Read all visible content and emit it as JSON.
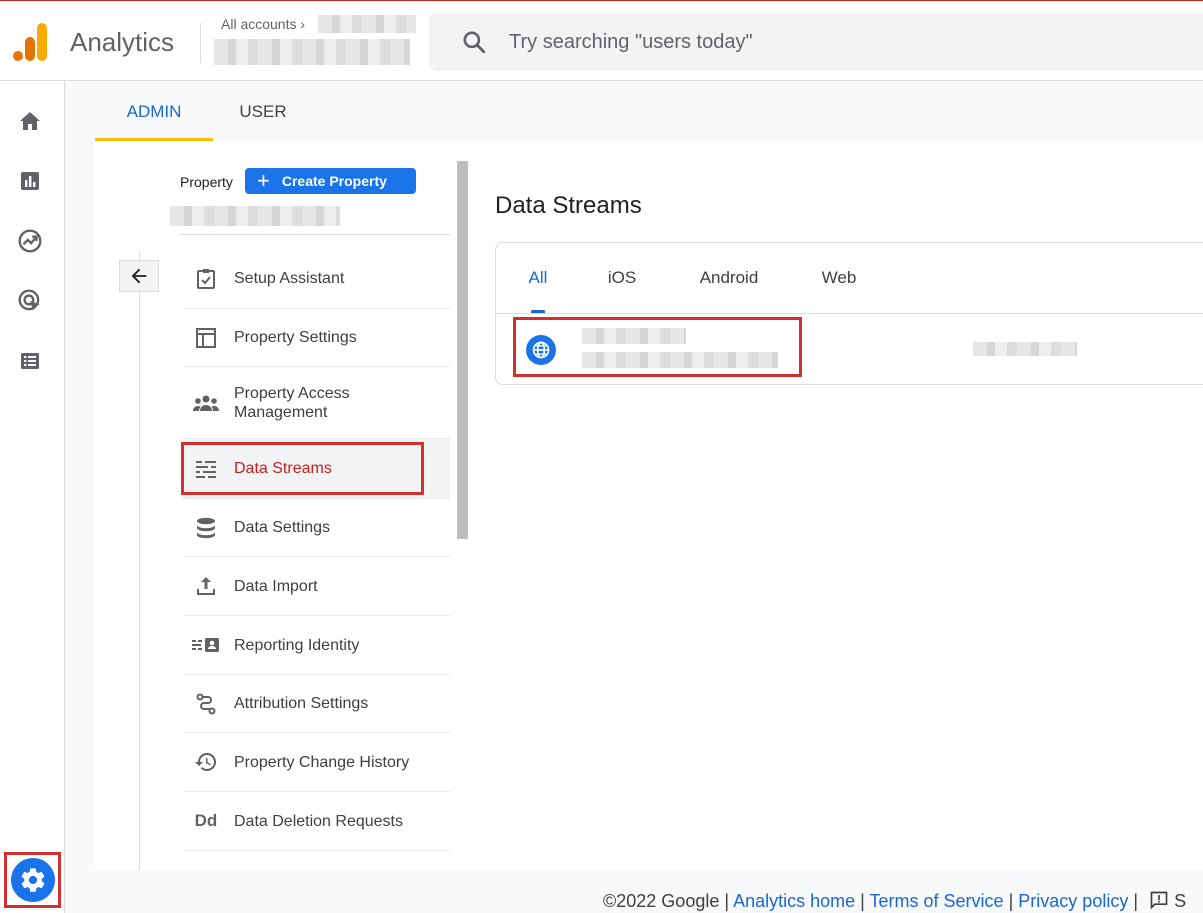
{
  "header": {
    "app_name": "Analytics",
    "account_crumb": "All accounts",
    "crumb_chevron": "›",
    "search_placeholder": "Try searching \"users today\""
  },
  "rail": {
    "items": [
      "home-icon",
      "reports-icon",
      "explore-icon",
      "advertising-icon",
      "configure-icon"
    ],
    "admin_icon": "gear-icon"
  },
  "admin_tabs": [
    {
      "label": "ADMIN",
      "active": true
    },
    {
      "label": "USER",
      "active": false
    }
  ],
  "property_panel": {
    "label": "Property",
    "create_button": "Create Property",
    "back_icon": "arrow-left-icon",
    "items": [
      {
        "label": "Setup Assistant",
        "icon": "clipboard-check-icon"
      },
      {
        "label": "Property Settings",
        "icon": "layout-icon"
      },
      {
        "label": "Property Access Management",
        "icon": "people-icon"
      },
      {
        "label": "Data Streams",
        "icon": "streams-icon",
        "active": true
      },
      {
        "label": "Data Settings",
        "icon": "database-icon"
      },
      {
        "label": "Data Import",
        "icon": "upload-icon"
      },
      {
        "label": "Reporting Identity",
        "icon": "identity-icon"
      },
      {
        "label": "Attribution Settings",
        "icon": "attribution-icon"
      },
      {
        "label": "Property Change History",
        "icon": "history-icon"
      },
      {
        "label": "Data Deletion Requests",
        "icon": "dd-icon",
        "glyph": "Dd"
      }
    ]
  },
  "main": {
    "title": "Data Streams",
    "stream_tabs": [
      {
        "label": "All",
        "active": true
      },
      {
        "label": "iOS"
      },
      {
        "label": "Android"
      },
      {
        "label": "Web"
      }
    ],
    "stream_icon": "globe-icon"
  },
  "footer": {
    "copyright": "©2022 Google",
    "sep": "|",
    "links": [
      "Analytics home",
      "Terms of Service",
      "Privacy policy"
    ],
    "feedback_icon": "feedback-icon",
    "feedback_partial": "S"
  },
  "colors": {
    "accent": "#1a73e8",
    "active_tab": "#1967d2",
    "highlight": "#d32f2f",
    "active_item": "#c5221f",
    "tab_underline": "#fbbc04"
  }
}
